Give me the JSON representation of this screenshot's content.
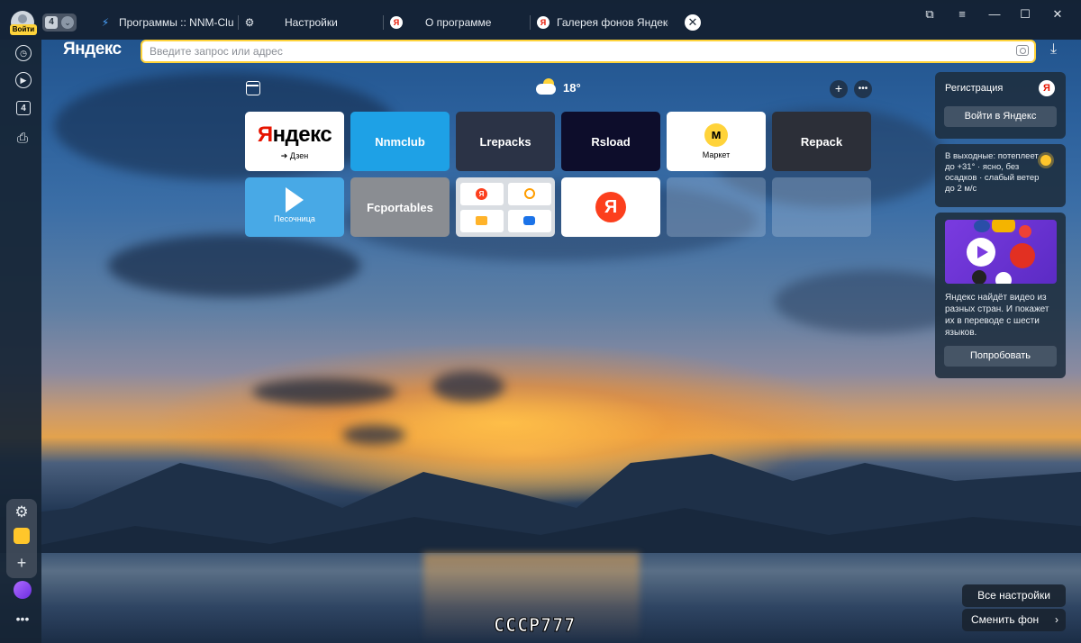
{
  "titlebar": {
    "login_label": "Войти",
    "tab_count": "4",
    "tabs": [
      {
        "title": "Программы :: NNM-Club",
        "icon": "nnm-club-icon"
      },
      {
        "title": "Настройки",
        "icon": "gear-icon"
      },
      {
        "title": "О программе",
        "icon": "yandex-icon"
      },
      {
        "title": "Галерея фонов Яндекс Бр",
        "icon": "yandex-icon"
      }
    ]
  },
  "addressbar": {
    "logo": "Яндекс",
    "placeholder": "Введите запрос или адрес"
  },
  "weather": {
    "temp": "18°"
  },
  "tiles": [
    {
      "label": "Яндекс",
      "sub": "➔ Дзен",
      "bg": "#ffffff"
    },
    {
      "label": "Nnmclub",
      "bg": "#1ea1e6"
    },
    {
      "label": "Lrepacks",
      "bg": "#2b3346"
    },
    {
      "label": "Rsload",
      "bg": "#0d0d2b"
    },
    {
      "label": "Маркет",
      "bg": "#ffffff"
    },
    {
      "label": "Repack",
      "bg": "#2c2f38"
    },
    {
      "label": "Песочница",
      "bg": "#48a9e6"
    },
    {
      "label": "Fcportables",
      "bg": "#8a8d92"
    },
    {
      "label": "",
      "bg": "#d9dde2"
    },
    {
      "label": "",
      "bg": "#ffffff"
    }
  ],
  "right_panel": {
    "register_title": "Регистрация",
    "login_button": "Войти в Яндекс",
    "weekend_forecast": "В выходные: потеплеет до +31° · ясно, без осадков · слабый ветер до 2 м/с",
    "promo_text": "Яндекс найдёт видео из разных стран. И покажет их в переводе с шести языков.",
    "try_button": "Попробовать"
  },
  "bottom": {
    "all_settings": "Все настройки",
    "change_bg": "Сменить фон",
    "watermark": "СССР777"
  },
  "colors": {
    "accent": "#ffd33a",
    "yandex_red": "#fc3f1d"
  }
}
